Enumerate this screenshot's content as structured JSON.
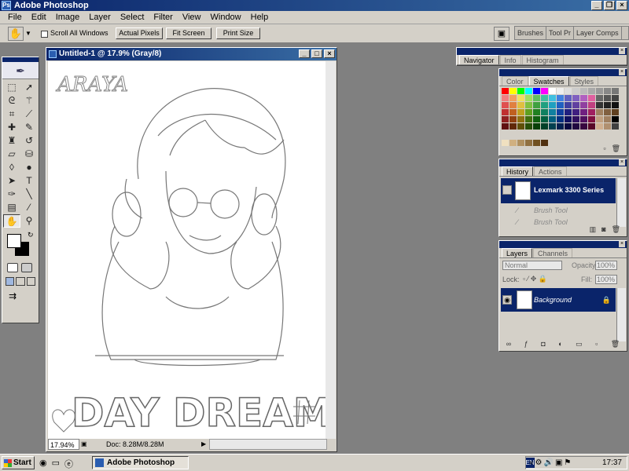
{
  "app": {
    "title": "Adobe Photoshop"
  },
  "menu": [
    "File",
    "Edit",
    "Image",
    "Layer",
    "Select",
    "Filter",
    "View",
    "Window",
    "Help"
  ],
  "options": {
    "scroll_all": "Scroll All Windows",
    "actual_pixels": "Actual Pixels",
    "fit_screen": "Fit Screen",
    "print_size": "Print Size",
    "palette_well": [
      "Brushes",
      "Tool Pr",
      "Layer Comps"
    ]
  },
  "document": {
    "title": "Untitled-1 @ 17.9% (Gray/8)",
    "zoom": "17.94%",
    "doc_info": "Doc: 8.28M/8.28M",
    "artwork": {
      "signature": "ARAYA",
      "heading": "DAY DREAM"
    }
  },
  "navigator": {
    "tabs": [
      "Navigator",
      "Info",
      "Histogram"
    ]
  },
  "swatches": {
    "tabs": [
      "Color",
      "Swatches",
      "Styles"
    ],
    "colors": [
      "#ff0000",
      "#ffff00",
      "#00ff00",
      "#00ffff",
      "#0000ff",
      "#ff00ff",
      "#ffffff",
      "#eeeeee",
      "#dddddd",
      "#cccccc",
      "#bbbbbb",
      "#aaaaaa",
      "#999999",
      "#888888",
      "#777777",
      "#f08080",
      "#f0a060",
      "#f0e060",
      "#a0e060",
      "#60c060",
      "#40c0a0",
      "#40c0e0",
      "#4080e0",
      "#6060c0",
      "#8060c0",
      "#b060c0",
      "#e060a0",
      "#666666",
      "#555555",
      "#444444",
      "#e05050",
      "#e08040",
      "#e0c040",
      "#80c040",
      "#40a040",
      "#20a080",
      "#20a0c0",
      "#2060c0",
      "#4040a0",
      "#6040a0",
      "#9040a0",
      "#c04080",
      "#333333",
      "#222222",
      "#111111",
      "#c03030",
      "#c06020",
      "#c0a020",
      "#60a020",
      "#208020",
      "#108060",
      "#1080a0",
      "#1040a0",
      "#202080",
      "#402080",
      "#702080",
      "#a02060",
      "#a08060",
      "#806040",
      "#604020",
      "#902020",
      "#904010",
      "#907010",
      "#407010",
      "#106010",
      "#006040",
      "#006080",
      "#003080",
      "#101060",
      "#301060",
      "#501060",
      "#801040",
      "#c0a080",
      "#a08060",
      "#000000",
      "#601010",
      "#602808",
      "#605008",
      "#285008",
      "#084008",
      "#004028",
      "#004050",
      "#002050",
      "#080840",
      "#200840",
      "#380840",
      "#580828",
      "#d0b090",
      "#b09070",
      "#404040"
    ],
    "footer_colors": [
      "#f0e0c0",
      "#d0b080",
      "#b09060",
      "#907040",
      "#705020",
      "#503010"
    ]
  },
  "history": {
    "tabs": [
      "History",
      "Actions"
    ],
    "snapshot": "Lexmark 3300 Series",
    "items": [
      "Brush Tool",
      "Brush Tool"
    ]
  },
  "layers": {
    "tabs": [
      "Layers",
      "Channels"
    ],
    "blend_mode": "Normal",
    "opacity_label": "Opacity:",
    "opacity": "100%",
    "lock_label": "Lock:",
    "fill_label": "Fill:",
    "fill": "100%",
    "layer_name": "Background"
  },
  "taskbar": {
    "start": "Start",
    "item": "Adobe Photoshop",
    "clock": "17:37",
    "lang": "EN"
  }
}
